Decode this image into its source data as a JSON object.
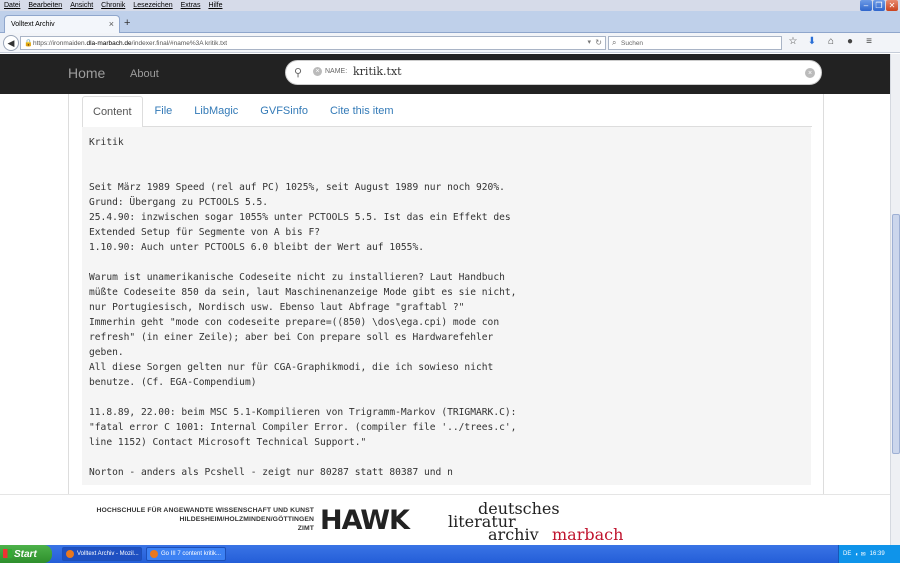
{
  "browser": {
    "menu": [
      "Datei",
      "Bearbeiten",
      "Ansicht",
      "Chronik",
      "Lesezeichen",
      "Extras",
      "Hilfe"
    ],
    "tab_title": "Volltext Archiv",
    "url_prefix": "https://ironmaiden.",
    "url_host": "dla-marbach.de",
    "url_suffix": "/indexer.final/#name%3A kritik.txt",
    "search_placeholder": "Suchen"
  },
  "site": {
    "brand": "Home",
    "about": "About",
    "search_tag": "NAME:",
    "search_value": "kritik.txt"
  },
  "tabs": [
    "Content",
    "File",
    "LibMagic",
    "GVFSinfo",
    "Cite this item"
  ],
  "content_text": "Kritik\n\n\nSeit März 1989 Speed (rel auf PC) 1025%, seit August 1989 nur noch 920%.\nGrund: Übergang zu PCTOOLS 5.5.\n25.4.90: inzwischen sogar 1055% unter PCTOOLS 5.5. Ist das ein Effekt des\nExtended Setup für Segmente von A bis F?\n1.10.90: Auch unter PCTOOLS 6.0 bleibt der Wert auf 1055%.\n\nWarum ist unamerikanische Codeseite nicht zu installieren? Laut Handbuch\nmüßte Codeseite 850 da sein, laut Maschinenanzeige Mode gibt es sie nicht,\nnur Portugiesisch, Nordisch usw. Ebenso laut Abfrage \"graftabl ?\"\nImmerhin geht \"mode con codeseite prepare=((850) \\dos\\ega.cpi) mode con\nrefresh\" (in einer Zeile); aber bei Con prepare soll es Hardwarefehler\ngeben.\nAll diese Sorgen gelten nur für CGA-Graphikmodi, die ich sowieso nicht\nbenutze. (Cf. EGA-Compendium)\n\n11.8.89, 22.00: beim MSC 5.1-Kompilieren von Trigramm-Markov (TRIGMARK.C):\n\"fatal error C 1001: Internal Compiler Error. (compiler file '../trees.c',\nline 1152) Contact Microsoft Technical Support.\"\n\nNorton - anders als Pcshell - zeigt nur 80287 statt 80387 und n",
  "footer": {
    "hawk_line1": "HOCHSCHULE FÜR ANGEWANDTE WISSENSCHAFT UND KUNST",
    "hawk_line2": "HILDESHEIM/HOLZMINDEN/GÖTTINGEN",
    "hawk_line3": "ZIMT",
    "hawk_logo": "HAWK",
    "dla_1": "deutsches",
    "dla_2": "literatur",
    "dla_3": "archiv",
    "dla_4": "marbach"
  },
  "taskbar": {
    "start": "Start",
    "task1": "Volltext Archiv - Mozil...",
    "task2": "Go III 7 content kritik...",
    "lang": "DE",
    "time": "16:39"
  }
}
